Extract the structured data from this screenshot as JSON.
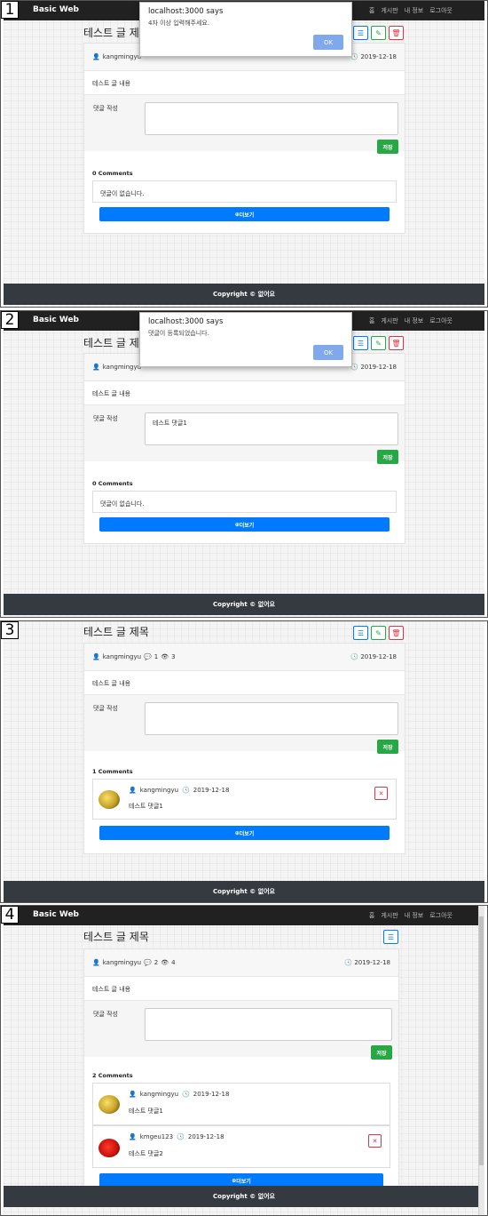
{
  "navbar": {
    "brand": "Basic Web",
    "links": [
      "홈",
      "게시판",
      "내 정보",
      "로그아웃"
    ]
  },
  "post": {
    "title": "테스트 글 제목",
    "author": "kangmingyu",
    "date": "2019-12-18",
    "content": "테스트 글 내용"
  },
  "reply": {
    "label": "댓글 작성",
    "save_label": "저장"
  },
  "more_label": "더보기",
  "footer": "Copyright © 없어요",
  "panels": [
    {
      "step": "1",
      "dialog": {
        "title": "localhost:3000 says",
        "message": "4자 이상 입력해주세요.",
        "ok": "OK"
      },
      "reply_value": "",
      "comments_count_label": "0 Comments",
      "empty_text": "댓글이 없습니다."
    },
    {
      "step": "2",
      "dialog": {
        "title": "localhost:3000 says",
        "message": "댓글이 등록되었습니다.",
        "ok": "OK"
      },
      "reply_value": "테스트 댓글1",
      "comments_count_label": "0 Comments",
      "empty_text": "댓글이 없습니다."
    },
    {
      "step": "3",
      "comment_count": "1",
      "view_count": "3",
      "reply_value": "",
      "comments_count_label": "1 Comments",
      "comments": [
        {
          "author": "kangmingyu",
          "date": "2019-12-18",
          "text": "테스트 댓글1"
        }
      ]
    },
    {
      "step": "4",
      "comment_count": "2",
      "view_count": "4",
      "reply_value": "",
      "comments_count_label": "2 Comments",
      "comments": [
        {
          "author": "kangmingyu",
          "date": "2019-12-18",
          "text": "테스트 댓글1"
        },
        {
          "author": "kmgeu123",
          "date": "2019-12-18",
          "text": "테스트 댓글2"
        }
      ]
    }
  ]
}
